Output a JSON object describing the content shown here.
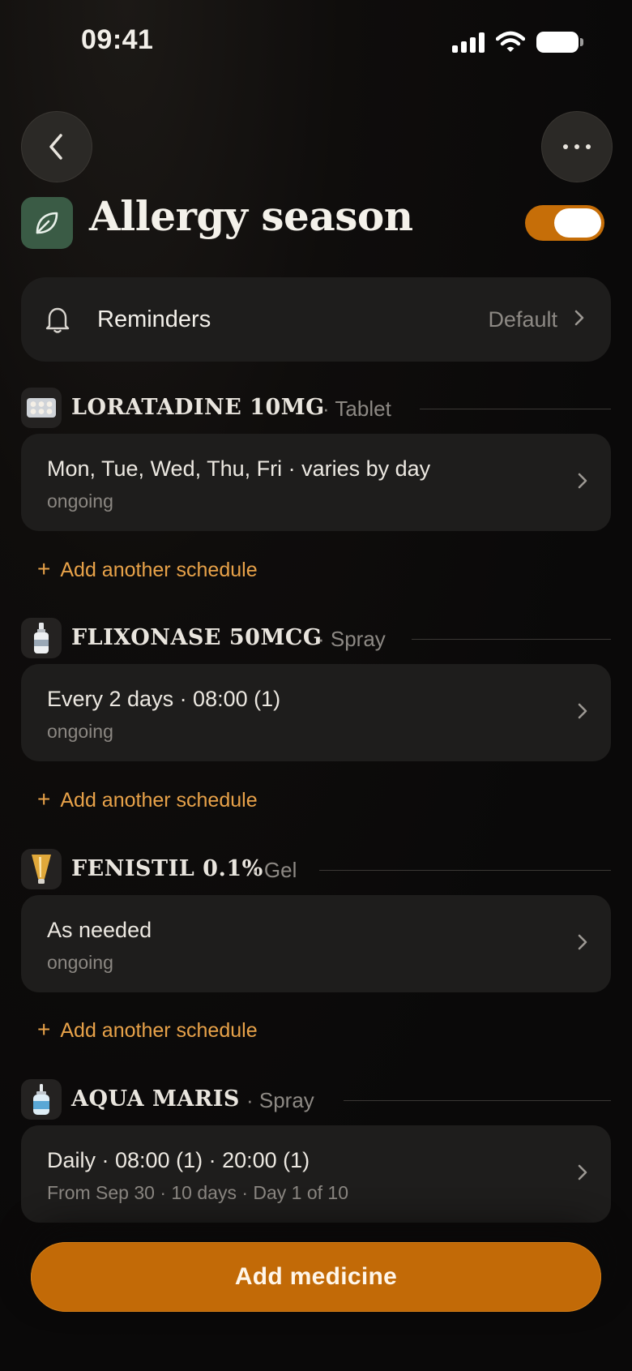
{
  "status_bar": {
    "time": "09:41",
    "icons": [
      "signal-icon",
      "wifi-icon",
      "battery-icon"
    ]
  },
  "nav": {
    "back_icon": "chevron-left-icon",
    "more_icon": "ellipsis-icon"
  },
  "plan": {
    "icon": "leaf-icon",
    "icon_color": "#3a5b45",
    "title": "Allergy season",
    "enabled": true,
    "toggle_color": "#c66e08"
  },
  "reminders": {
    "icon": "bell-icon",
    "label": "Reminders",
    "value": "Default"
  },
  "medicines": [
    {
      "icon": "tablet-icon",
      "name": "LORATADINE 10MG",
      "form": "· Tablet",
      "schedule_main": "Mon, Tue, Wed, Thu, Fri · varies by day",
      "schedule_sub": "ongoing",
      "add_label": "Add another schedule"
    },
    {
      "icon": "spray-bottle-icon",
      "name": "FLIXONASE 50MCG",
      "form": "· Spray",
      "schedule_main": "Every 2 days · 08:00 (1)",
      "schedule_sub": "ongoing",
      "add_label": "Add another schedule"
    },
    {
      "icon": "gel-tube-icon",
      "name": "FENISTIL 0.1%",
      "form": "· Gel",
      "schedule_main": "As needed",
      "schedule_sub": "ongoing",
      "add_label": "Add another schedule"
    },
    {
      "icon": "nasal-spray-icon",
      "name": "AQUA MARIS",
      "form": "· Spray",
      "schedule_main": "Daily · 08:00 (1) · 20:00 (1)",
      "schedule_sub": "From Sep 30 · 10 days · Day 1 of 10"
    }
  ],
  "cta": {
    "label": "Add medicine",
    "color": "#c26a07"
  },
  "accent_color": "#e8a249"
}
